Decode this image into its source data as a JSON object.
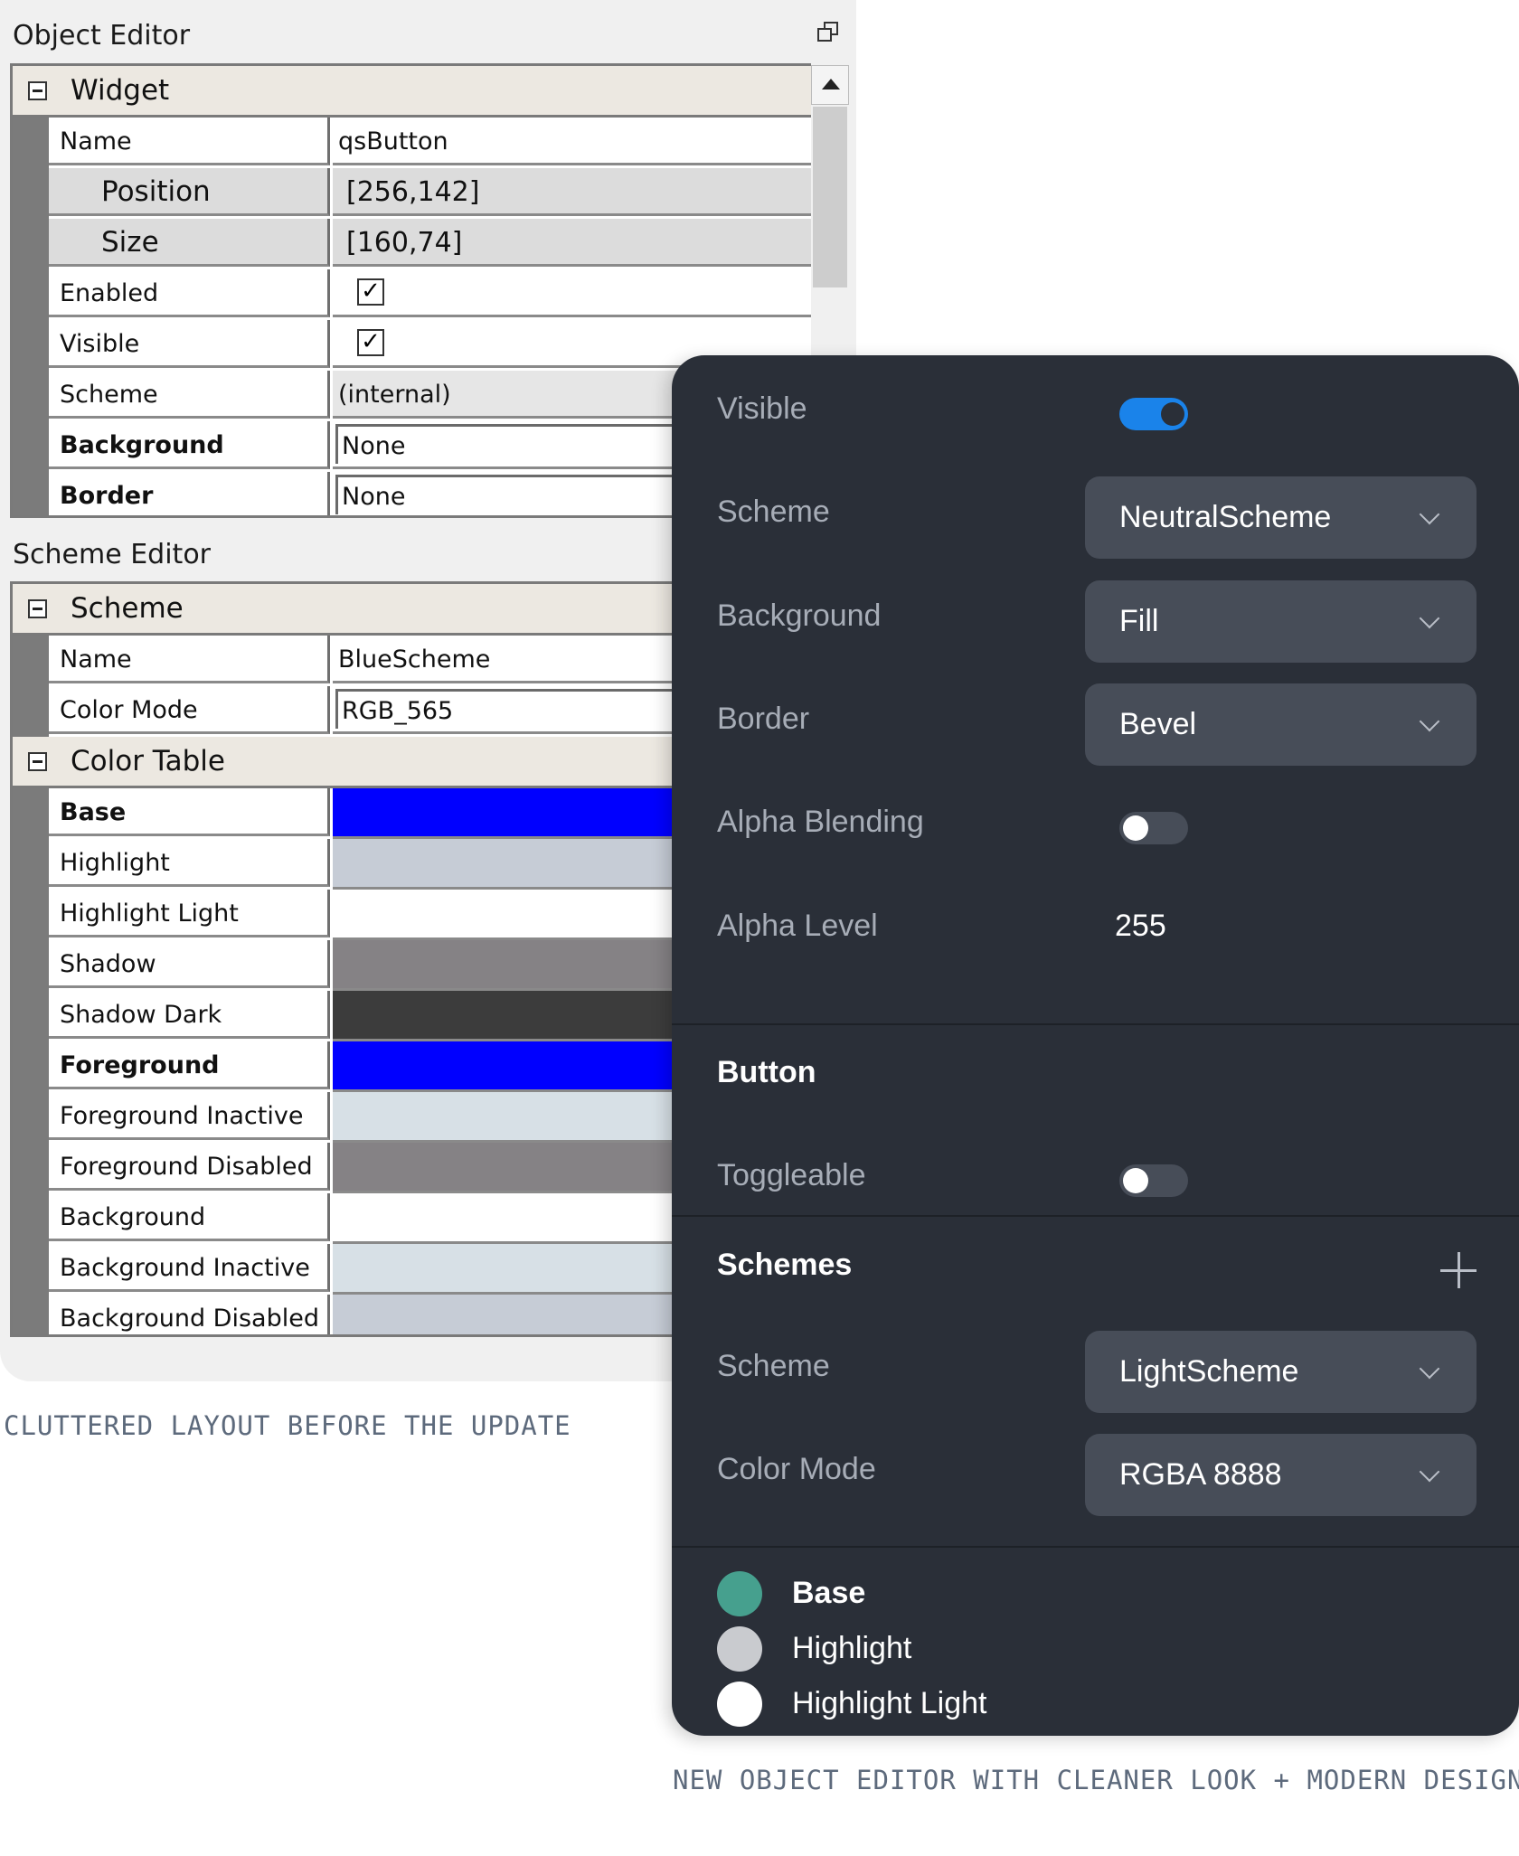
{
  "old_editor": {
    "object_editor_title": "Object Editor",
    "widget_group": "Widget",
    "name_label": "Name",
    "name_value": "qsButton",
    "position_label": "Position",
    "position_value": "[256,142]",
    "size_label": "Size",
    "size_value": "[160,74]",
    "enabled_label": "Enabled",
    "enabled_checked": "✓",
    "visible_label": "Visible",
    "visible_checked": "✓",
    "scheme_label": "Scheme",
    "scheme_value": "(internal)",
    "background_label": "Background",
    "background_value": "None",
    "border_label": "Border",
    "border_value": "None",
    "scheme_editor_title": "Scheme Editor",
    "scheme_group": "Scheme",
    "scheme_name_label": "Name",
    "scheme_name_value": "BlueScheme",
    "color_mode_label": "Color Mode",
    "color_mode_value": "RGB_565",
    "color_table_group": "Color Table",
    "colors": [
      {
        "label": "Base",
        "color": "#0000ff",
        "bold": true
      },
      {
        "label": "Highlight",
        "color": "#c6ccd6",
        "bold": false
      },
      {
        "label": "Highlight Light",
        "color": "#ffffff",
        "bold": false
      },
      {
        "label": "Shadow",
        "color": "#858285",
        "bold": false
      },
      {
        "label": "Shadow Dark",
        "color": "#3c3c3c",
        "bold": false
      },
      {
        "label": "Foreground",
        "color": "#0000ff",
        "bold": true
      },
      {
        "label": "Foreground Inactive",
        "color": "#d7e0e6",
        "bold": false
      },
      {
        "label": "Foreground Disabled",
        "color": "#858285",
        "bold": false
      },
      {
        "label": "Background",
        "color": "#ffffff",
        "bold": false
      },
      {
        "label": "Background Inactive",
        "color": "#d7e0e6",
        "bold": false
      },
      {
        "label": "Background Disabled",
        "color": "#c6ccd6",
        "bold": false
      }
    ]
  },
  "captions": {
    "before": "CLUTTERED LAYOUT BEFORE THE UPDATE",
    "after": "NEW OBJECT EDITOR WITH CLEANER LOOK + MODERN DESIGN"
  },
  "new_editor": {
    "visible_label": "Visible",
    "visible_on": true,
    "scheme_label": "Scheme",
    "scheme_value": "NeutralScheme",
    "background_label": "Background",
    "background_value": "Fill",
    "border_label": "Border",
    "border_value": "Bevel",
    "alpha_blending_label": "Alpha Blending",
    "alpha_blending_on": false,
    "alpha_level_label": "Alpha Level",
    "alpha_level_value": "255",
    "button_section": "Button",
    "toggleable_label": "Toggleable",
    "toggleable_on": false,
    "schemes_section": "Schemes",
    "schemes_scheme_label": "Scheme",
    "schemes_scheme_value": "LightScheme",
    "color_mode_label": "Color Mode",
    "color_mode_value": "RGBA 8888",
    "colors": [
      {
        "label": "Base",
        "color": "#46a08e",
        "bold": true
      },
      {
        "label": "Highlight",
        "color": "#c9cbcf",
        "bold": false
      },
      {
        "label": "Highlight Light",
        "color": "#ffffff",
        "bold": false
      }
    ],
    "icons": {
      "add": "plus-icon",
      "dropdown": "chevron-down-icon"
    }
  }
}
